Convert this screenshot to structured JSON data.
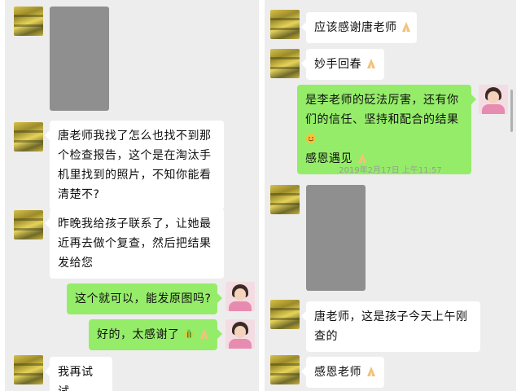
{
  "left": {
    "messages": [
      {
        "text": "唐老师我找了怎么也找不到那个检查报告，这个是在淘汰手机里找到的照片，不知你能看清楚不?"
      },
      {
        "text": "昨晚我给孩子联系了，让她最近再去做个复查，然后把结果发给您"
      },
      {
        "text": "这个就可以，能发原图吗?"
      },
      {
        "text": "好的，太感谢了"
      },
      {
        "text": "我再试试"
      }
    ]
  },
  "right": {
    "messages": [
      {
        "text": "应该感谢唐老师"
      },
      {
        "text": "妙手回春"
      },
      {
        "text": "是李老师的砭法厉害，还有你们的信任、坚持和配合的结果"
      },
      {
        "text": "感恩遇见"
      },
      {
        "text": "唐老师，这是孩子今天上午刚查的"
      },
      {
        "text": "感恩老师"
      }
    ],
    "timestamp": "2019年2月17日 上午11:57"
  },
  "colors": {
    "background": "#ededed",
    "incoming": "#ffffff",
    "outgoing": "#95ec69",
    "photo": "#8f8f8f"
  },
  "icons": [
    "pray-emoji",
    "smile-emoji",
    "bee-emoji"
  ]
}
